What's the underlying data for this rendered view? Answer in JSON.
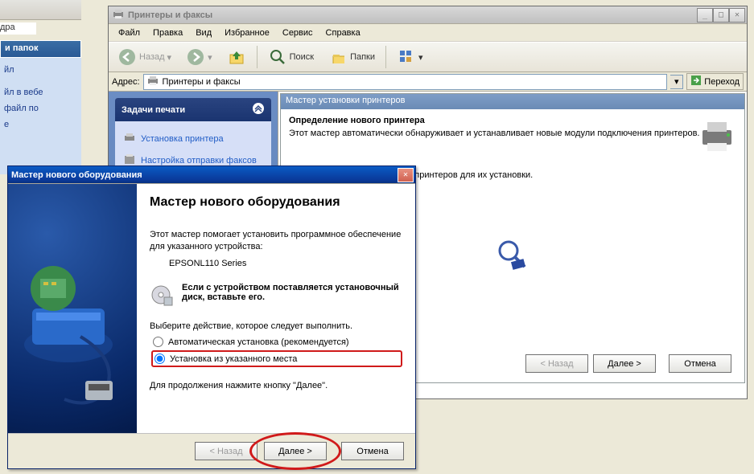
{
  "bg": {
    "line1": "дра",
    "panel_title": "и папок",
    "items": [
      "йл",
      "",
      "йл в вебе",
      "файл по",
      "е"
    ]
  },
  "printers_window": {
    "title": "Принтеры и факсы",
    "menu": [
      "Файл",
      "Правка",
      "Вид",
      "Избранное",
      "Сервис",
      "Справка"
    ],
    "toolbar": {
      "back": "Назад",
      "search": "Поиск",
      "folders": "Папки"
    },
    "address_label": "Адрес:",
    "address_value": "Принтеры и факсы",
    "go": "Переход",
    "tasks": {
      "header": "Задачи печати",
      "items": [
        "Установка принтера",
        "Настройка отправки факсов"
      ]
    },
    "wizard": {
      "header": "Мастер установки принтеров",
      "title": "Определение нового принтера",
      "desc": "Этот мастер автоматически обнаруживает и устанавливает новые модули подключения принтеров.",
      "searchtext": "ск новых самонастраиваемых принтеров для их установки.",
      "back": "< Назад",
      "next": "Далее >",
      "cancel": "Отмена"
    }
  },
  "hw_wizard": {
    "title": "Мастер нового оборудования",
    "heading": "Мастер нового оборудования",
    "p1": "Этот мастер помогает установить программное обеспечение для указанного устройства:",
    "device": "EPSONL110 Series",
    "p2": "Если с устройством поставляется установочный диск, вставьте его.",
    "p3": "Выберите действие, которое следует выполнить.",
    "radio1": "Автоматическая установка (рекомендуется)",
    "radio2": "Установка из указанного места",
    "p_continue": "Для продолжения нажмите кнопку \"Далее\".",
    "back": "< Назад",
    "next": "Далее >",
    "cancel": "Отмена"
  }
}
